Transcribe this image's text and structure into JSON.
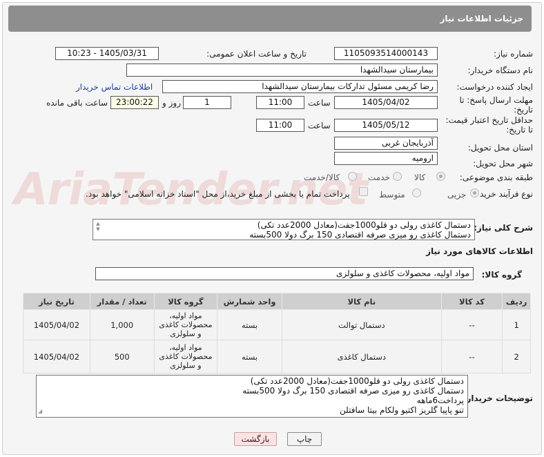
{
  "header": {
    "title": "جزئیات اطلاعات نیاز"
  },
  "watermark": {
    "text": "AriaTender.net"
  },
  "form": {
    "need_number_label": "شماره نیاز:",
    "need_number": "1105093514000143",
    "announce_label": "تاریخ و ساعت اعلان عمومی:",
    "announce_value": "1405/03/31 - 10:23",
    "buyer_org_label": "نام دستگاه خریدار:",
    "buyer_org": "بیمارستان سیدالشهدا",
    "creator_label": "ایجاد کننده درخواست:",
    "creator": "رضا کریمی مسئول تداركات بیمارستان سیدالشهدا",
    "contact_link": "اطلاعات تماس خریدار",
    "deadline_label_1": "مهلت ارسال پاسخ: تا",
    "deadline_label_2": "تاریخ:",
    "deadline_date": "1405/04/02",
    "time_word": "ساعت",
    "deadline_time": "11:00",
    "days_value": "1",
    "days_word": "روز و",
    "remaining_time": "23:00:22",
    "remaining_label": "ساعت باقی مانده",
    "validity_label_1": "حداقل تاریخ اعتبار قیمت:",
    "validity_label_2": "تا تاریخ:",
    "validity_date": "1405/05/12",
    "validity_time": "11:00",
    "province_label": "استان محل تحویل:",
    "province": "آذربایجان غربی",
    "city_label": "شهر محل تحویل:",
    "city": "ارومیه",
    "category_label": "طبقه بندی موضوعی:",
    "category_options": [
      "کالا",
      "خدمت",
      "کالا/خدمت"
    ],
    "process_label": "نوع فرآیند خرید :",
    "process_options": [
      "جزیی",
      "متوسط"
    ],
    "payment_note": "پرداخت تمام یا بخشی از مبلغ خرید،از محل \"اسناد خزانه اسلامی\" خواهد بود.",
    "summary_label": "شرح کلی نیاز:",
    "summary_lines": [
      "دستمال کاغذی رولی دو قلو1000جفت(معادل 2000عدد تکی)",
      "دستمال کاغذی رو میزی صرفه اقتصادی 150 برگ دولا 500بسته"
    ],
    "goods_info_title": "اطلاعات کالاهای مورد نیاز",
    "goods_group_label": "گروه کالا:",
    "goods_group": "مواد اولیه، محصولات کاغذی و سلولزی"
  },
  "table": {
    "headers": [
      "ردیف",
      "کد کالا",
      "نام کالا",
      "واحد شمارش",
      "گروه کالا",
      "تعداد / مقدار",
      "تاریخ نیاز"
    ],
    "rows": [
      {
        "index": "1",
        "code": "--",
        "name": "دستمال توالت",
        "unit": "بسته",
        "group": "مواد اولیه، محصولات کاغذی و سلولزی",
        "qty": "1,000",
        "date": "1405/04/02"
      },
      {
        "index": "2",
        "code": "--",
        "name": "دستمال کاغذی",
        "unit": "بسته",
        "group": "مواد اولیه، محصولات کاغذی و سلولزی",
        "qty": "500",
        "date": "1405/04/02"
      }
    ]
  },
  "notes": {
    "label": "توضیحات خریدار:",
    "lines": [
      "دستمال کاغذی رولی دو قلو1000جفت(معادل 2000عدد تکی)",
      "دستمال کاغذی رو میزی صرفه اقتصادی 150 برگ دولا 500بسته",
      "پرداخت6ماهه",
      "تنو پاپیا گلریز اکتیو ولکام بیتا سافتلن"
    ]
  },
  "buttons": {
    "print": "چاپ",
    "back": "بازگشت"
  }
}
